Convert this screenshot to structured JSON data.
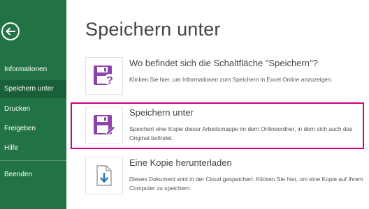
{
  "sidebar": {
    "items": [
      {
        "label": "Informationen"
      },
      {
        "label": "Speichern unter"
      },
      {
        "label": "Drucken"
      },
      {
        "label": "Freigeben"
      },
      {
        "label": "Hilfe"
      },
      {
        "label": "Beenden"
      }
    ],
    "active": "Speichern unter",
    "background": "#217346",
    "active_background": "#19603a"
  },
  "main": {
    "title": "Speichern unter",
    "options": [
      {
        "title": "Wo befindet sich die Schaltfläche \"Speichern\"?",
        "description": "Klicken Sie hier, um Informationen zum Speichern in Excel Online anzuzeigen.",
        "icon": "save-question-icon"
      },
      {
        "title": "Speichern unter",
        "description": "Speichert eine Kopie dieser Arbeitsmappe im dem Onlineordner, in dem sich auch das Original befindet.",
        "icon": "save-as-icon"
      },
      {
        "title": "Eine Kopie herunterladen",
        "description": "Dieses Dokument wird in der Cloud gespeichert. Klicken Sie hier, um eine Kopie auf Ihrem Computer zu speichern.",
        "icon": "download-document-icon"
      }
    ]
  },
  "colors": {
    "icon_purple": "#8e44ad",
    "highlight": "#d5007f"
  }
}
